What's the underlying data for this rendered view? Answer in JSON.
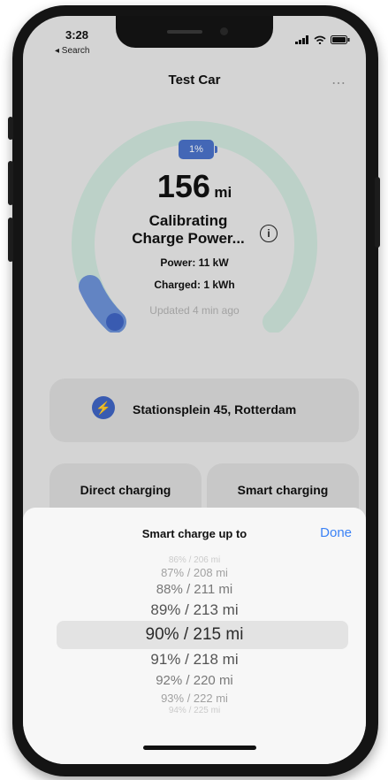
{
  "status_bar": {
    "time": "3:28",
    "back_label": "◂ Search"
  },
  "header": {
    "title": "Test Car",
    "more_icon": "⋯"
  },
  "charge": {
    "battery_percent": "1%",
    "range_value": "156",
    "range_unit": "mi",
    "status_line1": "Calibrating",
    "status_line2": "Charge Power...",
    "info_glyph": "i",
    "power": "Power: 11 kW",
    "charged": "Charged: 1 kWh",
    "updated": "Updated 4 min ago",
    "charge_level": 0.01
  },
  "location": {
    "icon": "⚡",
    "address": "Stationsplein 45, Rotterdam"
  },
  "modes": [
    {
      "label": "Direct charging",
      "color": "#3f65c3"
    },
    {
      "label": "Smart charging",
      "color": "#4aa88a"
    }
  ],
  "sheet": {
    "title": "Smart charge up to",
    "done_label": "Done",
    "options": [
      "86% / 206 mi",
      "87% / 208 mi",
      "88% / 211 mi",
      "89% / 213 mi",
      "90% / 215 mi",
      "91% / 218 mi",
      "92% / 220 mi",
      "93% / 222 mi",
      "94% / 225 mi"
    ],
    "selected_index": 4
  },
  "colors": {
    "accent_blue": "#3f65c3",
    "gauge_green": "#cfe6dc",
    "done_blue": "#3b82f6"
  }
}
